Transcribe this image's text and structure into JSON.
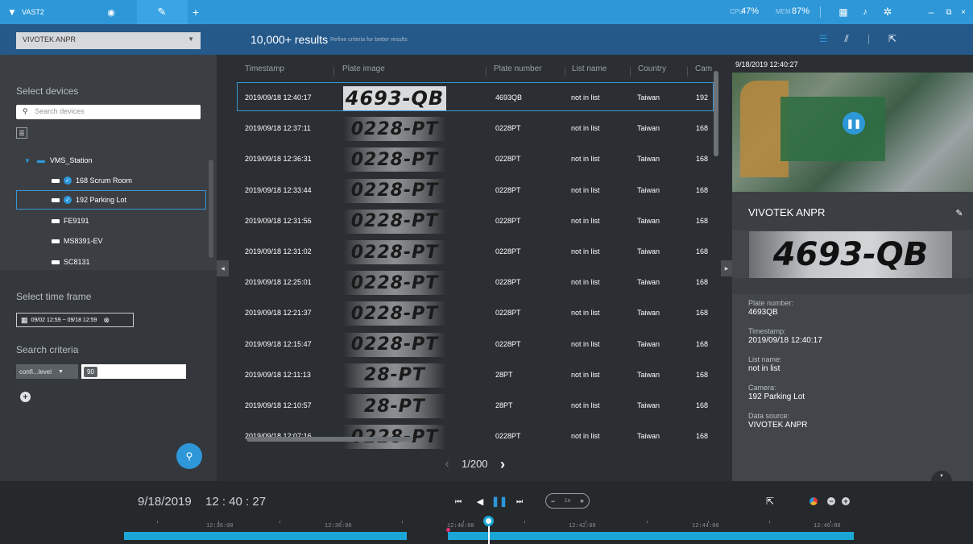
{
  "app": {
    "name": "VAST2",
    "cpu_label": "CPU",
    "cpu_value": "47%",
    "mem_label": "MEM",
    "mem_value": "87%"
  },
  "toolbar": {
    "device_select": "VIVOTEK ANPR",
    "results_count": "10,000+ results",
    "results_hint": "Refine criteria for better results"
  },
  "left": {
    "select_devices_label": "Select devices",
    "search_placeholder": "Search devices",
    "tree_root": "VMS_Station",
    "devices": [
      {
        "name": "168 Scrum Room",
        "checked": true
      },
      {
        "name": "192 Parking Lot",
        "checked": true
      },
      {
        "name": "FE9191",
        "checked": false
      },
      {
        "name": "MS8391-EV",
        "checked": false
      },
      {
        "name": "SC8131",
        "checked": false
      }
    ],
    "time_frame_label": "Select time frame",
    "time_frame_value": "09/02 12:59 ~ 09/18 12:59",
    "criteria_label": "Search criteria",
    "criteria_field": "confi...level",
    "criteria_value": "90"
  },
  "table": {
    "columns": [
      "Timestamp",
      "Plate image",
      "Plate number",
      "List name",
      "Country",
      "Cam"
    ],
    "rows": [
      {
        "timestamp": "2019/09/18 12:40:17",
        "plate_image": "4693-QB",
        "plate": "4693QB",
        "list": "not in list",
        "country": "Taiwan",
        "cam": "192"
      },
      {
        "timestamp": "2019/09/18 12:37:11",
        "plate_image": "0228-PT",
        "plate": "0228PT",
        "list": "not in list",
        "country": "Taiwan",
        "cam": "168"
      },
      {
        "timestamp": "2019/09/18 12:36:31",
        "plate_image": "0228-PT",
        "plate": "0228PT",
        "list": "not in list",
        "country": "Taiwan",
        "cam": "168"
      },
      {
        "timestamp": "2019/09/18 12:33:44",
        "plate_image": "0228-PT",
        "plate": "0228PT",
        "list": "not in list",
        "country": "Taiwan",
        "cam": "168"
      },
      {
        "timestamp": "2019/09/18 12:31:56",
        "plate_image": "0228-PT",
        "plate": "0228PT",
        "list": "not in list",
        "country": "Taiwan",
        "cam": "168"
      },
      {
        "timestamp": "2019/09/18 12:31:02",
        "plate_image": "0228-PT",
        "plate": "0228PT",
        "list": "not in list",
        "country": "Taiwan",
        "cam": "168"
      },
      {
        "timestamp": "2019/09/18 12:25:01",
        "plate_image": "0228-PT",
        "plate": "0228PT",
        "list": "not in list",
        "country": "Taiwan",
        "cam": "168"
      },
      {
        "timestamp": "2019/09/18 12:21:37",
        "plate_image": "0228-PT",
        "plate": "0228PT",
        "list": "not in list",
        "country": "Taiwan",
        "cam": "168"
      },
      {
        "timestamp": "2019/09/18 12:15:47",
        "plate_image": "0228-PT",
        "plate": "0228PT",
        "list": "not in list",
        "country": "Taiwan",
        "cam": "168"
      },
      {
        "timestamp": "2019/09/18 12:11:13",
        "plate_image": "28-PT",
        "plate": "28PT",
        "list": "not in list",
        "country": "Taiwan",
        "cam": "168"
      },
      {
        "timestamp": "2019/09/18 12:10:57",
        "plate_image": "28-PT",
        "plate": "28PT",
        "list": "not in list",
        "country": "Taiwan",
        "cam": "168"
      },
      {
        "timestamp": "2019/09/18 12:07:16",
        "plate_image": "0228-PT",
        "plate": "0228PT",
        "list": "not in list",
        "country": "Taiwan",
        "cam": "168"
      }
    ],
    "pagination": "1/200"
  },
  "right": {
    "video_timestamp": "9/18/2019 12:40:27",
    "source_title": "VIVOTEK ANPR",
    "plate_image": "4693-QB",
    "details": [
      {
        "label": "Plate number:",
        "value": "4693QB"
      },
      {
        "label": "Timestamp:",
        "value": "2019/09/18 12:40:17"
      },
      {
        "label": "List name:",
        "value": "not in list"
      },
      {
        "label": "Camera:",
        "value": "192 Parking Lot"
      },
      {
        "label": "Data source:",
        "value": "VIVOTEK ANPR"
      }
    ]
  },
  "playback": {
    "date": "9/18/2019",
    "time": "12 : 40 : 27",
    "speed": "1x",
    "timeline_labels": [
      "12:36:00",
      "12:38:00",
      "12:40:00",
      "12:42:00",
      "12:44:00",
      "12:46:00"
    ]
  },
  "colors": {
    "accent": "#2d97d8",
    "timeline": "#1ba6d6"
  }
}
